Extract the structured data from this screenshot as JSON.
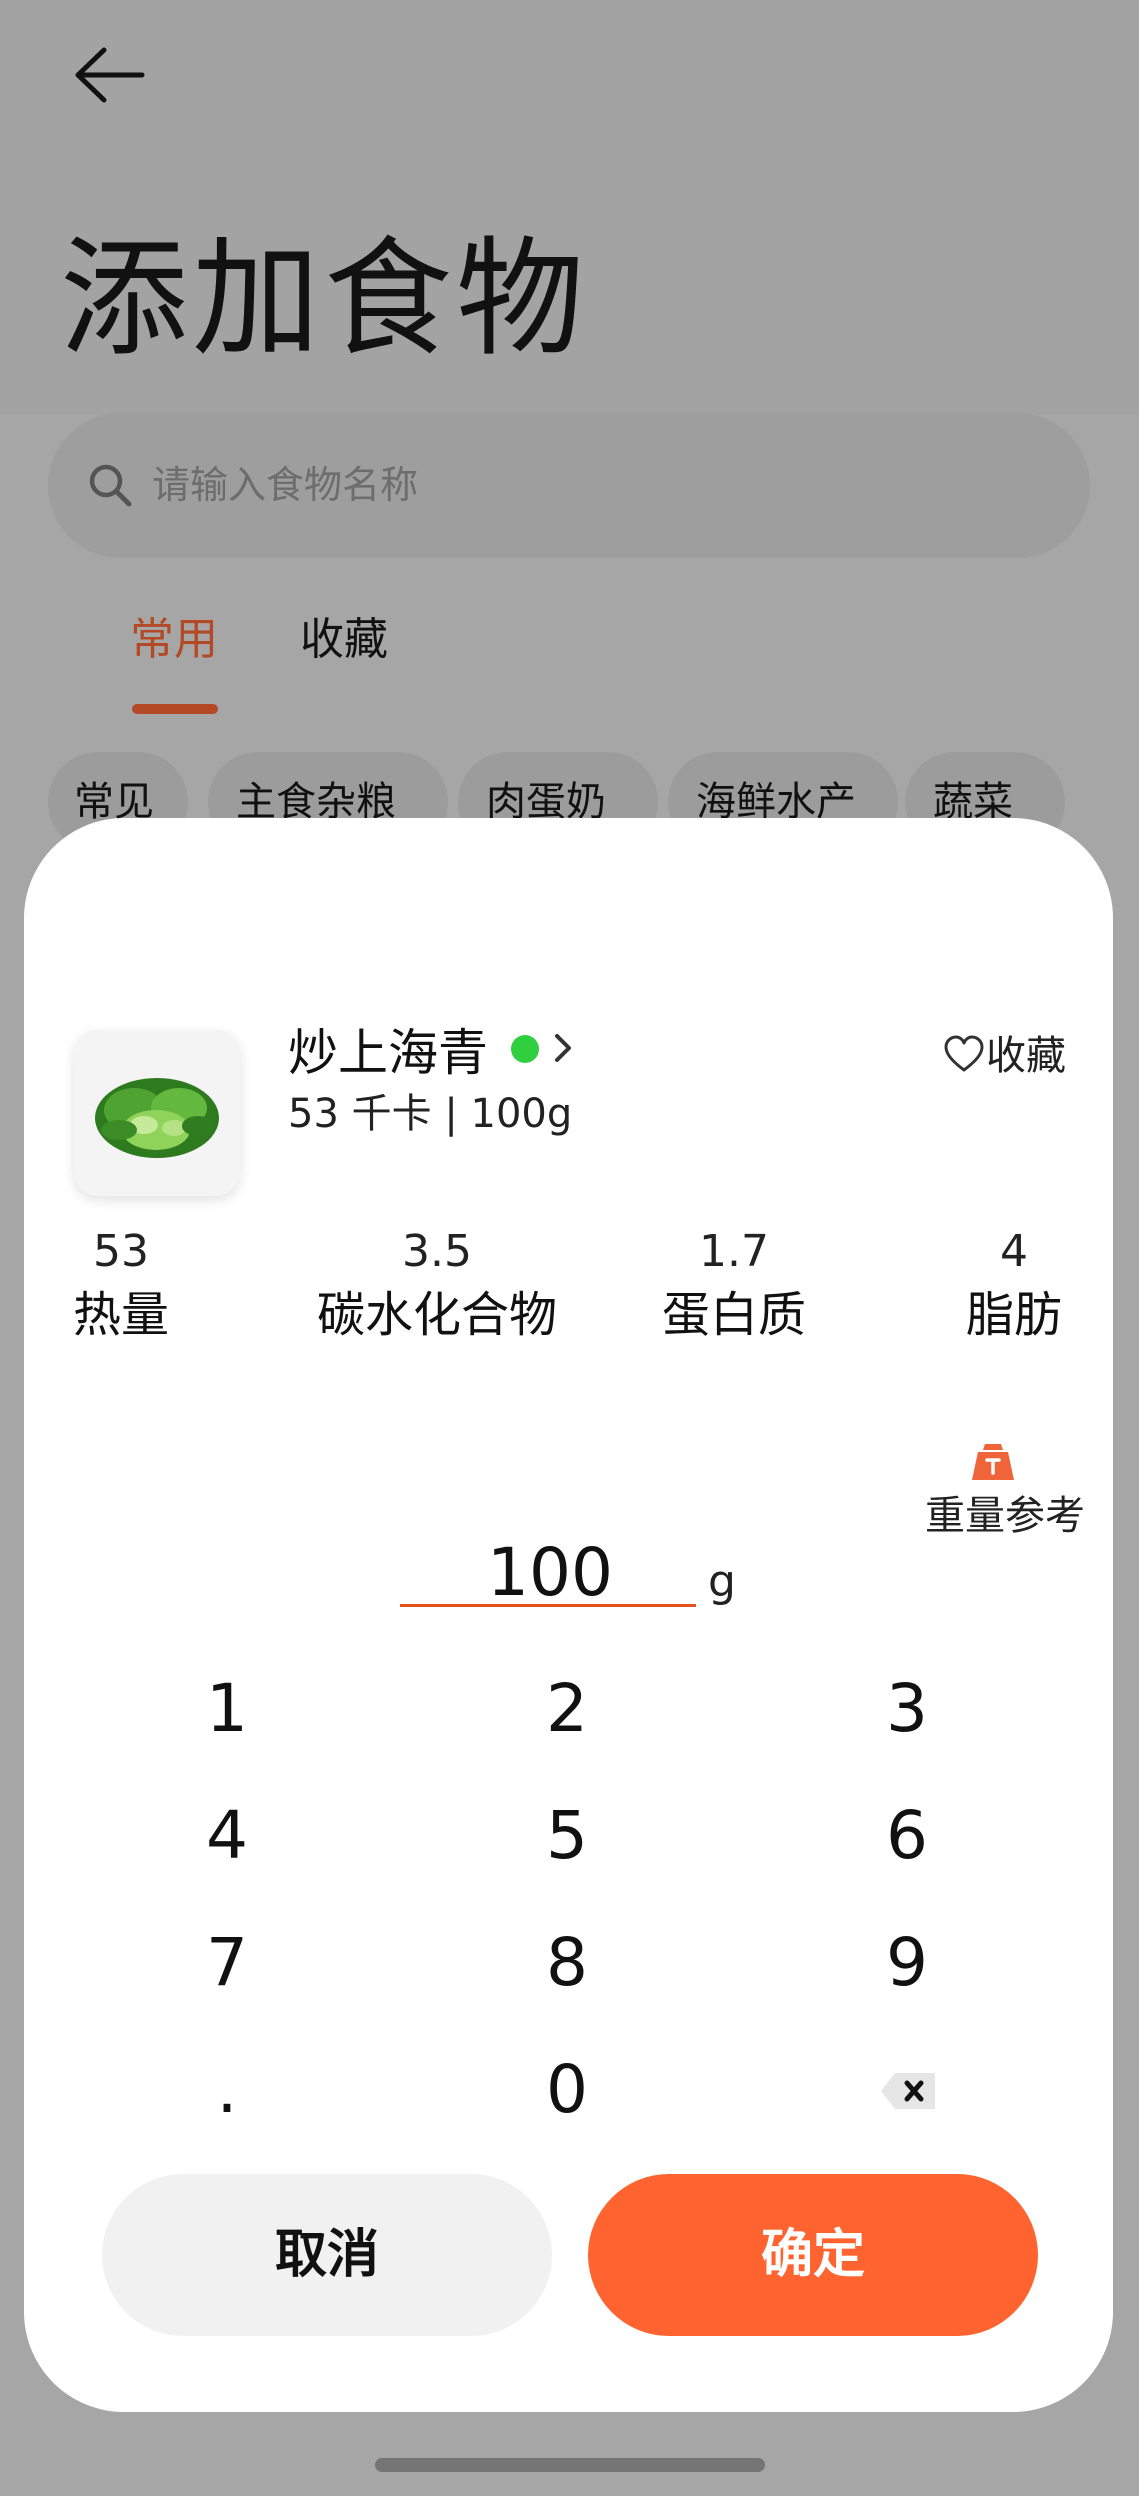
{
  "header": {
    "title": "添加食物"
  },
  "search": {
    "placeholder": "请输入食物名称"
  },
  "tabs": [
    {
      "label": "常用",
      "active": true
    },
    {
      "label": "收藏",
      "active": false
    }
  ],
  "categories": [
    "常见",
    "主食杂粮",
    "肉蛋奶",
    "海鲜水产",
    "蔬菜"
  ],
  "food": {
    "name": "炒上海青",
    "summary": "53 千卡 | 100g",
    "favorite_label": "收藏",
    "status_color": "#2fcf3f"
  },
  "nutrients": [
    {
      "value": "53",
      "label": "热量"
    },
    {
      "value": "3.5",
      "label": "碳水化合物"
    },
    {
      "value": "1.7",
      "label": "蛋白质"
    },
    {
      "value": "4",
      "label": "脂肪"
    }
  ],
  "weight_reference": {
    "label": "重量参考",
    "icon": "weight-icon"
  },
  "amount": {
    "value": "100",
    "unit": "g"
  },
  "keypad": {
    "keys": [
      "1",
      "2",
      "3",
      "4",
      "5",
      "6",
      "7",
      "8",
      "9",
      ".",
      "0"
    ],
    "delete_icon": "backspace-icon"
  },
  "actions": {
    "cancel": "取消",
    "confirm": "确定"
  },
  "colors": {
    "accent": "#ff6430",
    "accent_dimmed": "#b34a25"
  }
}
